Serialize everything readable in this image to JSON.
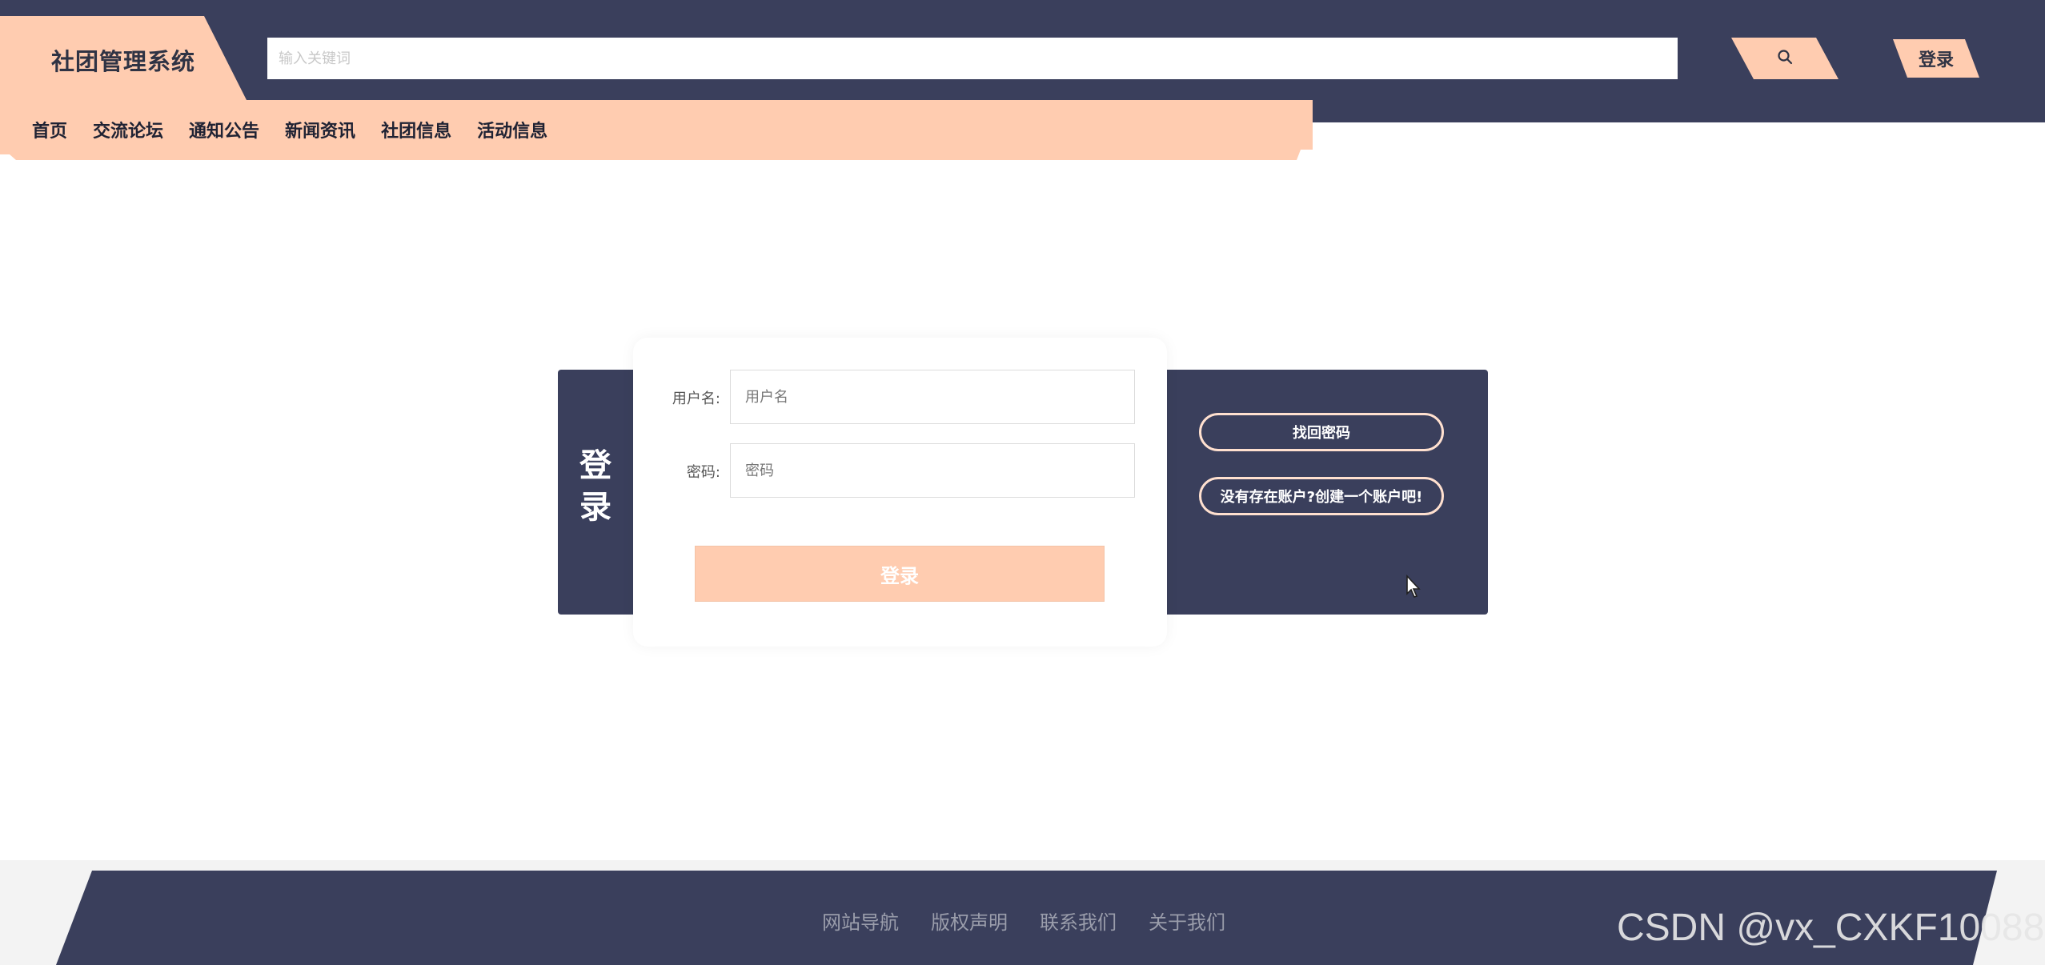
{
  "header": {
    "site_title": "社团管理系统",
    "search_placeholder": "输入关键词",
    "search_button_icon": "search-icon",
    "login_button": "登录"
  },
  "nav": {
    "items": [
      "首页",
      "交流论坛",
      "通知公告",
      "新闻资讯",
      "社团信息",
      "活动信息"
    ]
  },
  "login_card": {
    "side_title_line1": "登",
    "side_title_line2": "录",
    "username_label": "用户名:",
    "username_placeholder": "用户名",
    "password_label": "密码:",
    "password_placeholder": "密码",
    "submit_label": "登录",
    "forgot_password": "找回密码",
    "register_prompt": "没有存在账户?创建一个账户吧!"
  },
  "footer": {
    "links": [
      "网站导航",
      "版权声明",
      "联系我们",
      "关于我们"
    ]
  },
  "watermark": "CSDN @vx_CXKF10088",
  "colors": {
    "primary_dark": "#3a3f5c",
    "accent_peach": "#ffccb0"
  }
}
